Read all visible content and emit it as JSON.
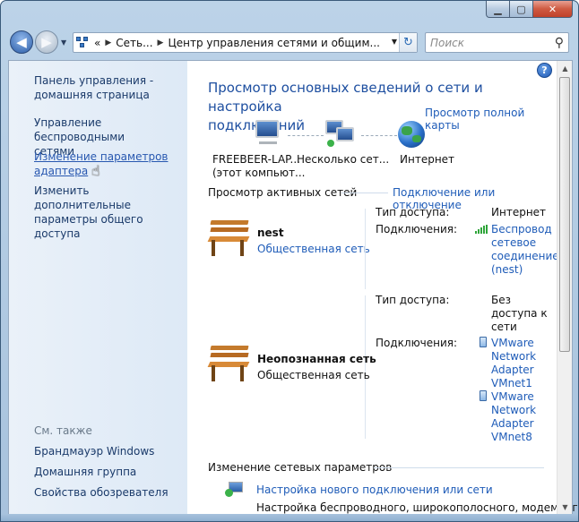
{
  "address": {
    "overflow": "«",
    "crumbs": [
      "Сеть...",
      "Центр управления сетями и общим..."
    ],
    "search_placeholder": "Поиск"
  },
  "left_nav": {
    "home": [
      "Панель управления -",
      "домашняя страница"
    ],
    "wireless": [
      "Управление беспроводными",
      "сетями"
    ],
    "adapter": [
      "Изменение параметров",
      "адаптера"
    ],
    "sharing": [
      "Изменить дополнительные",
      "параметры общего доступа"
    ],
    "see_also_title": "См. также",
    "see_also": [
      "Брандмауэр Windows",
      "Домашняя группа",
      "Свойства обозревателя"
    ]
  },
  "main": {
    "title": [
      "Просмотр основных сведений о сети и настройка",
      "подключений"
    ],
    "full_map_link": "Просмотр полной карты",
    "map": {
      "node1_name": "FREEBEER-LAP...",
      "node1_sub": "(этот компьют...",
      "node2": "Несколько сет...",
      "node3": "Интернет"
    },
    "active_title": "Просмотр активных сетей",
    "connect_link": "Подключение или отключение",
    "net1": {
      "name": "nest",
      "type": "Общественная сеть",
      "access_label": "Тип доступа:",
      "access_value": "Интернет",
      "conn_label": "Подключения:",
      "conn_value": [
        "Беспровод",
        "сетевое",
        "соединение",
        "(nest)"
      ]
    },
    "net2": {
      "name": "Неопознанная сеть",
      "type": "Общественная сеть",
      "access_label": "Тип доступа:",
      "access_value": [
        "Без",
        "доступа к",
        "сети"
      ],
      "conn_label": "Подключения:",
      "conn_a": [
        "VMware",
        "Network",
        "Adapter",
        "VMnet1"
      ],
      "conn_b": [
        "VMware",
        "Network",
        "Adapter",
        "VMnet8"
      ]
    },
    "change_title": "Изменение сетевых параметров",
    "setup_link": "Настройка нового подключения или сети",
    "setup_desc": "Настройка беспроводного, широкополосного, модемного,"
  },
  "icons": {
    "help": "?",
    "search": "⚲",
    "refresh": "↻"
  }
}
